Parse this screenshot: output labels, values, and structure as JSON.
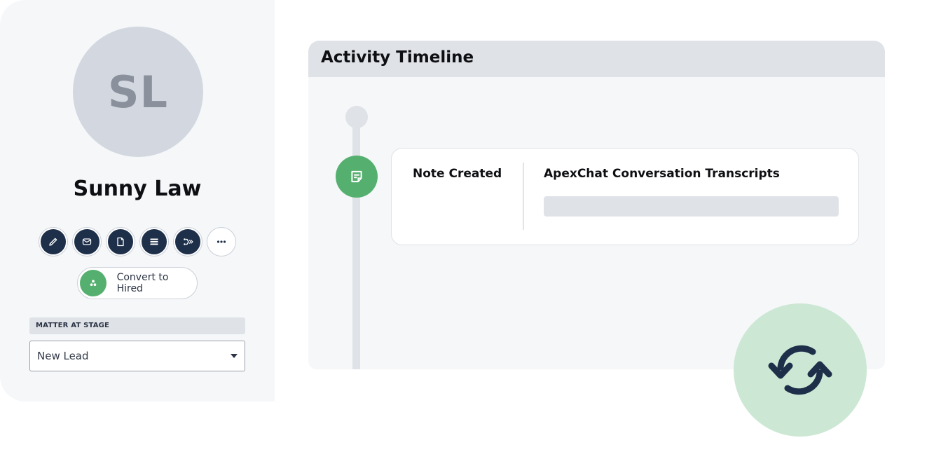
{
  "profile": {
    "initials": "SL",
    "name": "Sunny Law",
    "actions": [
      {
        "name": "edit",
        "icon": "pencil-icon"
      },
      {
        "name": "email",
        "icon": "envelope-icon"
      },
      {
        "name": "document",
        "icon": "document-icon"
      },
      {
        "name": "list",
        "icon": "stacked-list-icon"
      },
      {
        "name": "workflow",
        "icon": "branch-arrow-icon"
      },
      {
        "name": "more",
        "icon": "more-horizontal-icon"
      }
    ],
    "convert_button": {
      "label": "Convert to Hired",
      "icon": "person-group-icon"
    },
    "stage": {
      "label": "MATTER AT STAGE",
      "selected": "New Lead"
    }
  },
  "timeline": {
    "title": "Activity Timeline",
    "events": [
      {
        "type": "Note Created",
        "icon": "note-icon",
        "title": "ApexChat Conversation Transcripts"
      }
    ]
  },
  "sync_badge": {
    "icon": "sync-arrows-icon"
  },
  "colors": {
    "navy": "#1e2f4a",
    "green": "#55b06f",
    "mint": "#cce8d4",
    "panel_bg": "#f5f7f9",
    "header_gray": "#dfe2e7",
    "avatar_gray": "#d3d8e0"
  }
}
